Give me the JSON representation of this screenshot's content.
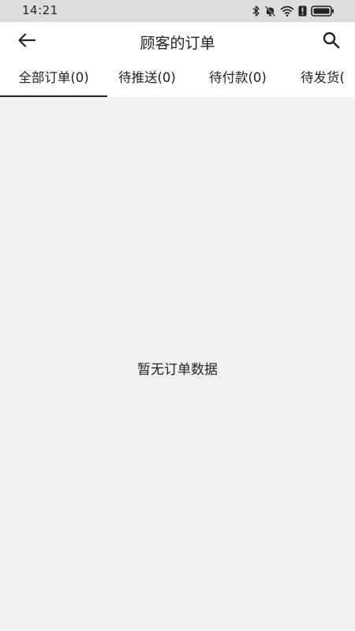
{
  "status_bar": {
    "time": "14:21",
    "icons": [
      "bluetooth-icon",
      "mute-icon",
      "wifi-icon",
      "alert-icon",
      "battery-icon"
    ]
  },
  "header": {
    "title": "顾客的订单",
    "back_icon": "back-arrow-icon",
    "search_icon": "search-icon"
  },
  "tabs": [
    {
      "label": "全部订单(0)",
      "active": true
    },
    {
      "label": "待推送(0)",
      "active": false
    },
    {
      "label": "待付款(0)",
      "active": false
    },
    {
      "label": "待发货(",
      "active": false
    }
  ],
  "empty_state": {
    "message": "暂无订单数据"
  },
  "colors": {
    "background": "#f2f2f2",
    "surface": "#ffffff",
    "status_bar": "#dcdcdc",
    "text": "#222222",
    "active_indicator": "#222222"
  }
}
